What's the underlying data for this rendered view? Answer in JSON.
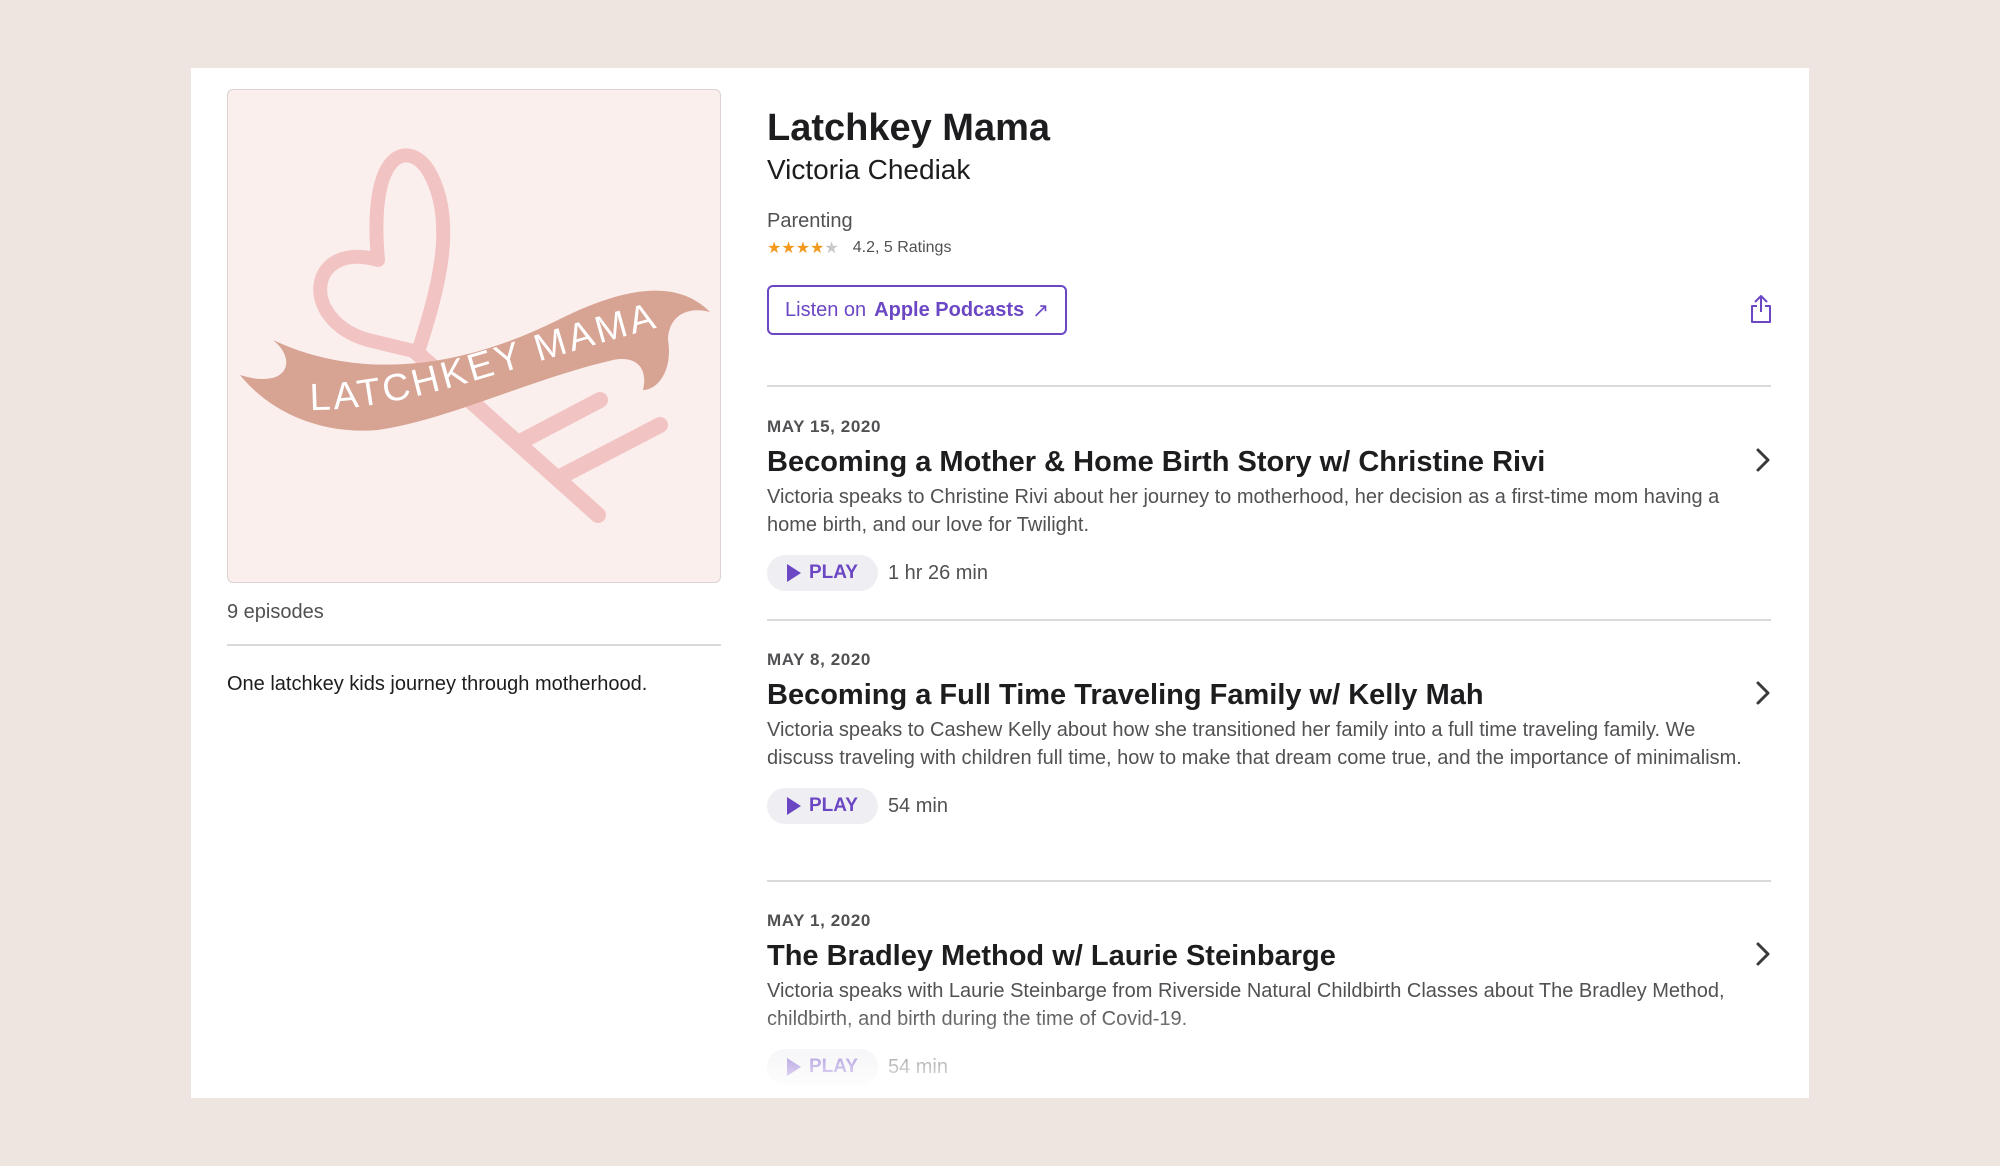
{
  "podcast": {
    "title": "Latchkey Mama",
    "author": "Victoria Chediak",
    "genre": "Parenting",
    "rating": 4.2,
    "rating_text": "4.2, 5 Ratings",
    "stars": {
      "filled": 4,
      "total": 5
    },
    "artwork_text": "LATCHKEY MAMA",
    "episode_count": "9 episodes",
    "description": "One latchkey kids journey through motherhood."
  },
  "listen_button": {
    "prefix": "Listen on",
    "label": "Apple Podcasts",
    "arrow": "↗"
  },
  "icons": {
    "share": "share-icon",
    "chevron": "chevron-right-icon",
    "play": "play-icon"
  },
  "colors": {
    "accent": "#6c47c4",
    "star": "#f39a1e",
    "background": "#efe5e0",
    "artwork_bg": "#fbefee",
    "banner": "#d7a393",
    "key": "#f2c3c3"
  },
  "episodes": [
    {
      "date": "MAY 15, 2020",
      "title": "Becoming a Mother & Home Birth Story w/ Christine Rivi",
      "summary": "Victoria speaks to Christine Rivi about her journey to motherhood, her decision as a first-time mom having a home birth, and our love for Twilight.",
      "play_label": "PLAY",
      "duration": "1 hr 26 min"
    },
    {
      "date": "MAY 8, 2020",
      "title": "Becoming a Full Time Traveling Family w/ Kelly Mah",
      "summary": "Victoria speaks to Cashew Kelly about how she transitioned her family into a full time traveling family. We discuss traveling with children full time, how to make that dream come true, and the importance of minimalism.",
      "play_label": "PLAY",
      "duration": "54 min"
    },
    {
      "date": "MAY 1, 2020",
      "title": "The Bradley Method w/ Laurie Steinbarge",
      "summary": "Victoria speaks with Laurie Steinbarge from Riverside Natural Childbirth Classes about The Bradley Method, childbirth, and birth during the time of Covid-19.",
      "play_label": "PLAY",
      "duration": "54 min"
    }
  ]
}
